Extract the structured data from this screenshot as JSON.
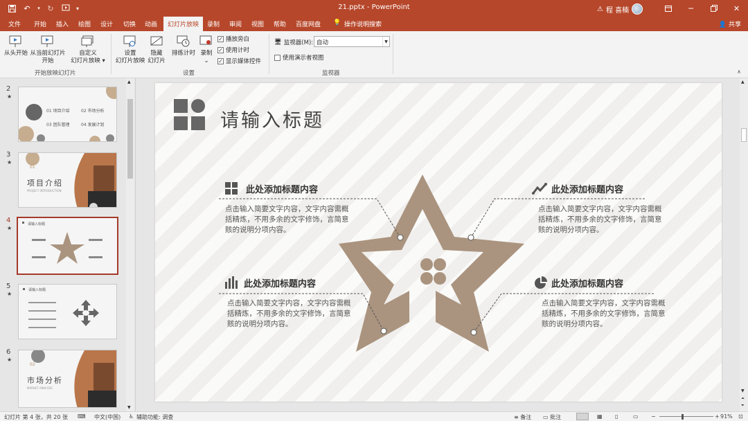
{
  "titlebar": {
    "doc_title": "21.pptx  -  PowerPoint",
    "user_name": "程 喜楠",
    "qa_icons": [
      "save-icon",
      "undo-icon",
      "redo-icon",
      "customize-icon"
    ]
  },
  "tabs": {
    "items": [
      "文件",
      "开始",
      "插入",
      "绘图",
      "设计",
      "切换",
      "动画",
      "幻灯片放映",
      "录制",
      "审阅",
      "视图",
      "帮助",
      "百度网盘"
    ],
    "active": "幻灯片放映",
    "search": "操作说明搜索",
    "share": "共享"
  },
  "ribbon": {
    "from_start": "从头开始",
    "from_current_1": "从当前幻灯片",
    "from_current_2": "开始",
    "custom_1": "自定义",
    "custom_2": "幻灯片放映",
    "group_start": "开始放映幻灯片",
    "setup_1": "设置",
    "setup_2": "幻灯片放映",
    "hide_1": "隐藏",
    "hide_2": "幻灯片",
    "rehearse": "排练计时",
    "record": "录制",
    "play_narration": "播放旁白",
    "use_timings": "使用计时",
    "show_media": "显示媒体控件",
    "group_setup": "设置",
    "monitor_label": "监视器(M):",
    "monitor_value": "自动",
    "presenter_view": "使用演示者视图",
    "group_monitor": "监视器"
  },
  "thumbnails": [
    {
      "num": "2",
      "star": "★",
      "items": [
        "01 项目介绍",
        "02 市场分析",
        "03 团队管理",
        "04 发展计划"
      ]
    },
    {
      "num": "3",
      "star": "★",
      "num_label": "01",
      "title": "项目介绍",
      "sub": "PROJECT INTRODUCTION"
    },
    {
      "num": "4",
      "star": "★",
      "title": "请输入标题"
    },
    {
      "num": "5",
      "star": "★",
      "title": "请输入标题"
    },
    {
      "num": "6",
      "star": "★",
      "num_label": "02",
      "title": "市场分析",
      "sub": "MARKET ANALYSIS"
    }
  ],
  "slide": {
    "title": "请输入标题",
    "blocks": [
      {
        "heading": "此处添加标题内容",
        "body": "点击输入简要文字内容，文字内容需概括精炼，不用多余的文字修饰，言简意赅的说明分项内容。"
      },
      {
        "heading": "此处添加标题内容",
        "body": "点击输入简要文字内容，文字内容需概括精炼，不用多余的文字修饰，言简意赅的说明分项内容。"
      },
      {
        "heading": "此处添加标题内容",
        "body": "点击输入简要文字内容，文字内容需概括精炼，不用多余的文字修饰，言简意赅的说明分项内容。"
      },
      {
        "heading": "此处添加标题内容",
        "body": "点击输入简要文字内容，文字内容需概括精炼，不用多余的文字修饰，言简意赅的说明分项内容。"
      }
    ],
    "star_color": "#aa9480"
  },
  "statusbar": {
    "slide_info": "幻灯片 第 4 张，共 20 张",
    "language": "中文(中国)",
    "accessibility": "辅助功能: 调查",
    "notes": "备注",
    "comments": "批注",
    "zoom": "91%"
  },
  "colors": {
    "accent": "#b7472a",
    "ribbon_bg": "#f3f3f3"
  }
}
